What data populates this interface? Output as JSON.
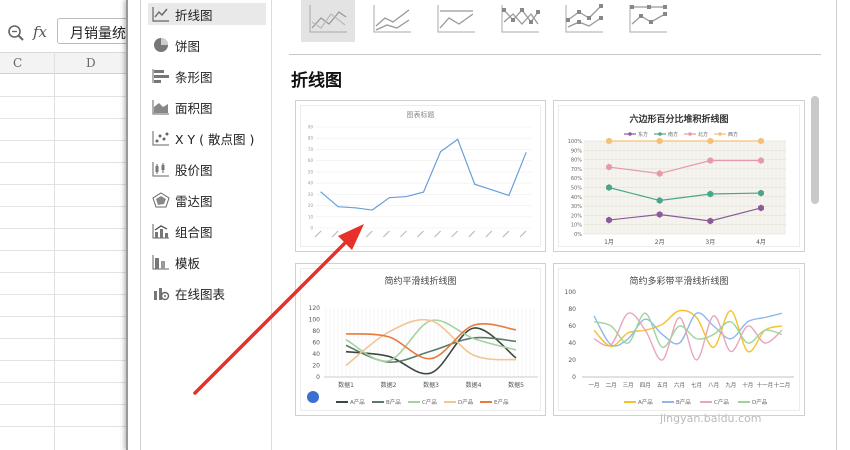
{
  "formula_bar": {
    "fx": "fx",
    "cell_value": "月销量统"
  },
  "columns": [
    "C",
    "D"
  ],
  "sidebar": {
    "items": [
      {
        "label": "折线图",
        "icon": "line-chart-icon",
        "active": true
      },
      {
        "label": "饼图",
        "icon": "pie-chart-icon"
      },
      {
        "label": "条形图",
        "icon": "bar-chart-icon"
      },
      {
        "label": "面积图",
        "icon": "area-chart-icon"
      },
      {
        "label": "X Y ( 散点图 )",
        "icon": "scatter-chart-icon"
      },
      {
        "label": "股价图",
        "icon": "stock-chart-icon"
      },
      {
        "label": "雷达图",
        "icon": "radar-chart-icon"
      },
      {
        "label": "组合图",
        "icon": "combo-chart-icon"
      },
      {
        "label": "模板",
        "icon": "template-icon"
      },
      {
        "label": "在线图表",
        "icon": "online-chart-icon"
      }
    ]
  },
  "section_title": "折线图",
  "cards": [
    {
      "title": "图表标题",
      "chart_data": {
        "type": "line",
        "values": [
          32,
          19,
          18,
          16,
          27,
          28,
          32,
          68,
          79,
          39,
          34,
          29,
          67
        ],
        "ylim": [
          0,
          90
        ],
        "yticks": [
          0,
          10,
          20,
          30,
          40,
          50,
          60,
          70,
          80,
          90
        ],
        "color": "#6a9fd8"
      }
    },
    {
      "title": "六边形百分比堆积折线图",
      "chart_data": {
        "type": "line",
        "categories": [
          "1月",
          "2月",
          "3月",
          "4月"
        ],
        "yticks": [
          "0%",
          "10%",
          "20%",
          "30%",
          "40%",
          "50%",
          "60%",
          "70%",
          "80%",
          "90%",
          "100%"
        ],
        "legend": [
          "东方",
          "南方",
          "北方",
          "西方"
        ],
        "series": [
          {
            "name": "东方",
            "values": [
              0.15,
              0.21,
              0.14,
              0.28
            ],
            "color": "#8d5a97"
          },
          {
            "name": "南方",
            "values": [
              0.5,
              0.36,
              0.43,
              0.44
            ],
            "color": "#4aa58a"
          },
          {
            "name": "北方",
            "values": [
              0.72,
              0.65,
              0.79,
              0.79
            ],
            "color": "#e69aa8"
          },
          {
            "name": "西方",
            "values": [
              1.0,
              1.0,
              1.0,
              1.0
            ],
            "color": "#f5c07a"
          }
        ]
      }
    },
    {
      "title": "简约平滑线折线图",
      "chart_data": {
        "type": "line",
        "categories": [
          "数据1",
          "数据2",
          "数据3",
          "数据4",
          "数据5"
        ],
        "ylim": [
          0,
          120
        ],
        "yticks": [
          0,
          20,
          40,
          60,
          80,
          100,
          120
        ],
        "legend": [
          "A产品",
          "B产品",
          "C产品",
          "D产品",
          "E产品"
        ],
        "series": [
          {
            "name": "A产品",
            "values": [
              44,
              36,
              7,
              85,
              33
            ],
            "color": "#3a4a40"
          },
          {
            "name": "B产品",
            "values": [
              55,
              26,
              45,
              68,
              62
            ],
            "color": "#5a7a6a"
          },
          {
            "name": "C产品",
            "values": [
              65,
              28,
              98,
              67,
              47
            ],
            "color": "#a7d1a0"
          },
          {
            "name": "D产品",
            "values": [
              20,
              78,
              98,
              38,
              30
            ],
            "color": "#f1c596"
          },
          {
            "name": "E产品",
            "values": [
              75,
              70,
              32,
              90,
              82
            ],
            "color": "#e87a3c"
          }
        ]
      }
    },
    {
      "title": "简约多彩带平滑线折线图",
      "chart_data": {
        "type": "line",
        "categories": [
          "一月",
          "二月",
          "三月",
          "四月",
          "五月",
          "六月",
          "七月",
          "八月",
          "九月",
          "十月",
          "十一月",
          "十二月"
        ],
        "ylim": [
          0,
          100
        ],
        "yticks": [
          0,
          20,
          40,
          60,
          80,
          100
        ],
        "legend": [
          "A产品",
          "B产品",
          "C产品",
          "D产品"
        ],
        "series": [
          {
            "name": "A产品",
            "values": [
              55,
              36,
              52,
              55,
              62,
              78,
              70,
              35,
              78,
              30,
              55,
              60
            ],
            "color": "#f5c12e"
          },
          {
            "name": "B产品",
            "values": [
              72,
              38,
              45,
              68,
              50,
              40,
              75,
              60,
              45,
              65,
              70,
              75
            ],
            "color": "#8fb8e8"
          },
          {
            "name": "C产品",
            "values": [
              45,
              38,
              75,
              55,
              20,
              70,
              20,
              72,
              30,
              60,
              40,
              55
            ],
            "color": "#e9a4be"
          },
          {
            "name": "D产品",
            "values": [
              65,
              60,
              40,
              75,
              35,
              60,
              45,
              50,
              65,
              40,
              55,
              50
            ],
            "color": "#9ed49a"
          }
        ]
      }
    }
  ],
  "watermark": "jingyan.baidu.com"
}
